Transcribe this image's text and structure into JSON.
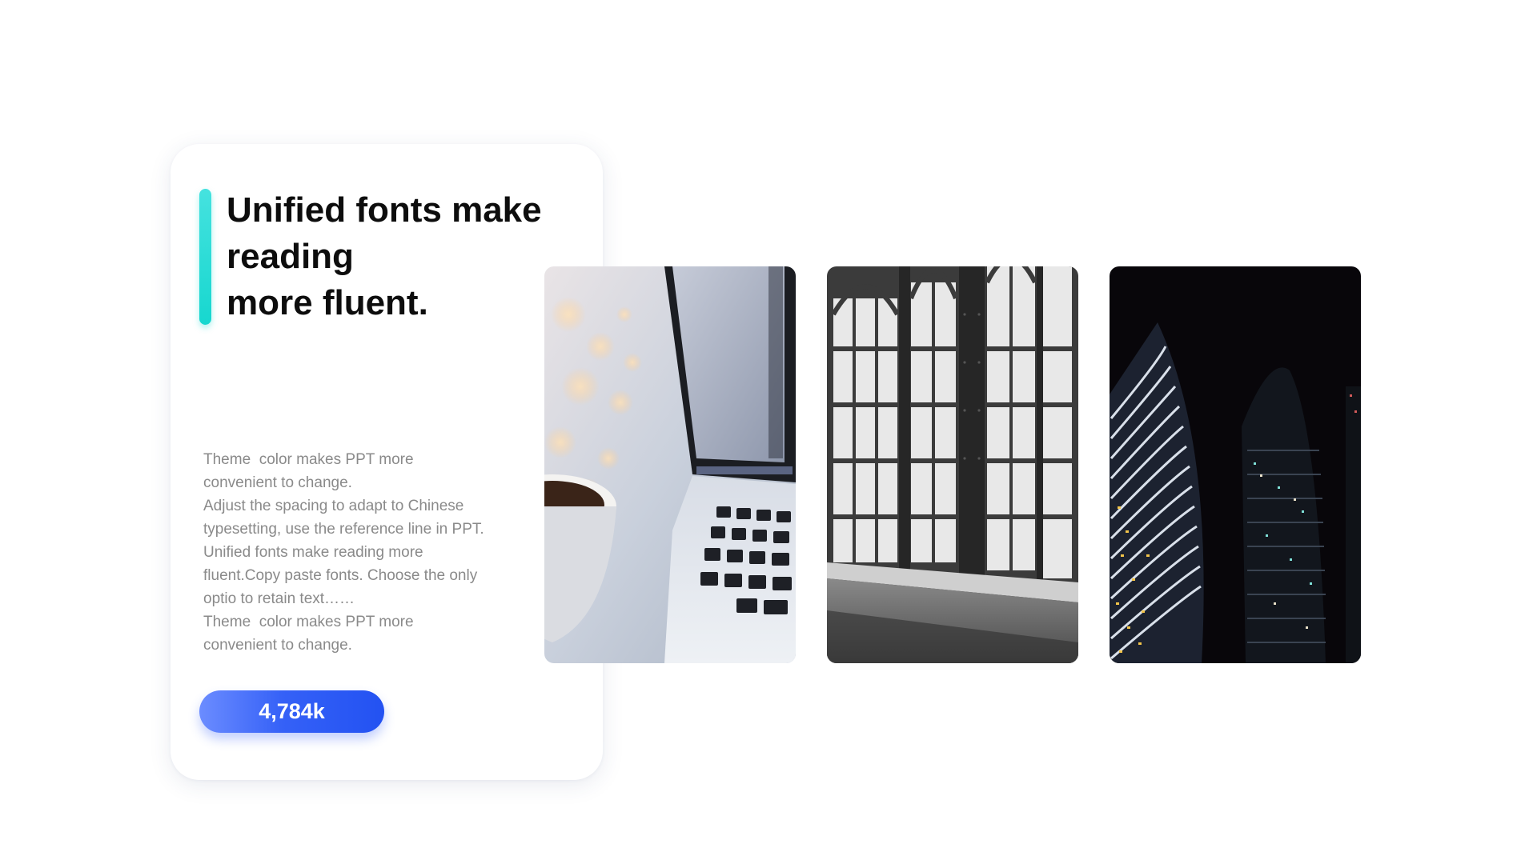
{
  "card": {
    "title_lines": [
      "Unified fonts make",
      "reading",
      "more fluent."
    ],
    "body_lines": [
      "Theme  color makes PPT more",
      "convenient to change.",
      "Adjust the spacing to adapt to Chinese",
      "typesetting, use the reference line in PPT.",
      "Unified fonts make reading more",
      "fluent.Copy paste fonts. Choose the only",
      "optio to retain text……",
      "Theme  color makes PPT more",
      "convenient to change."
    ],
    "stat_value": "4,784k"
  },
  "photos": [
    {
      "subject": "laptop-and-coffee-photo"
    },
    {
      "subject": "arched-windows-photo"
    },
    {
      "subject": "night-skyscrapers-photo"
    }
  ],
  "colors": {
    "accent_teal": "#17d7cf",
    "accent_blue": "#3561f7",
    "title_text": "#0d0d0d",
    "body_text": "#8a8a8a"
  }
}
